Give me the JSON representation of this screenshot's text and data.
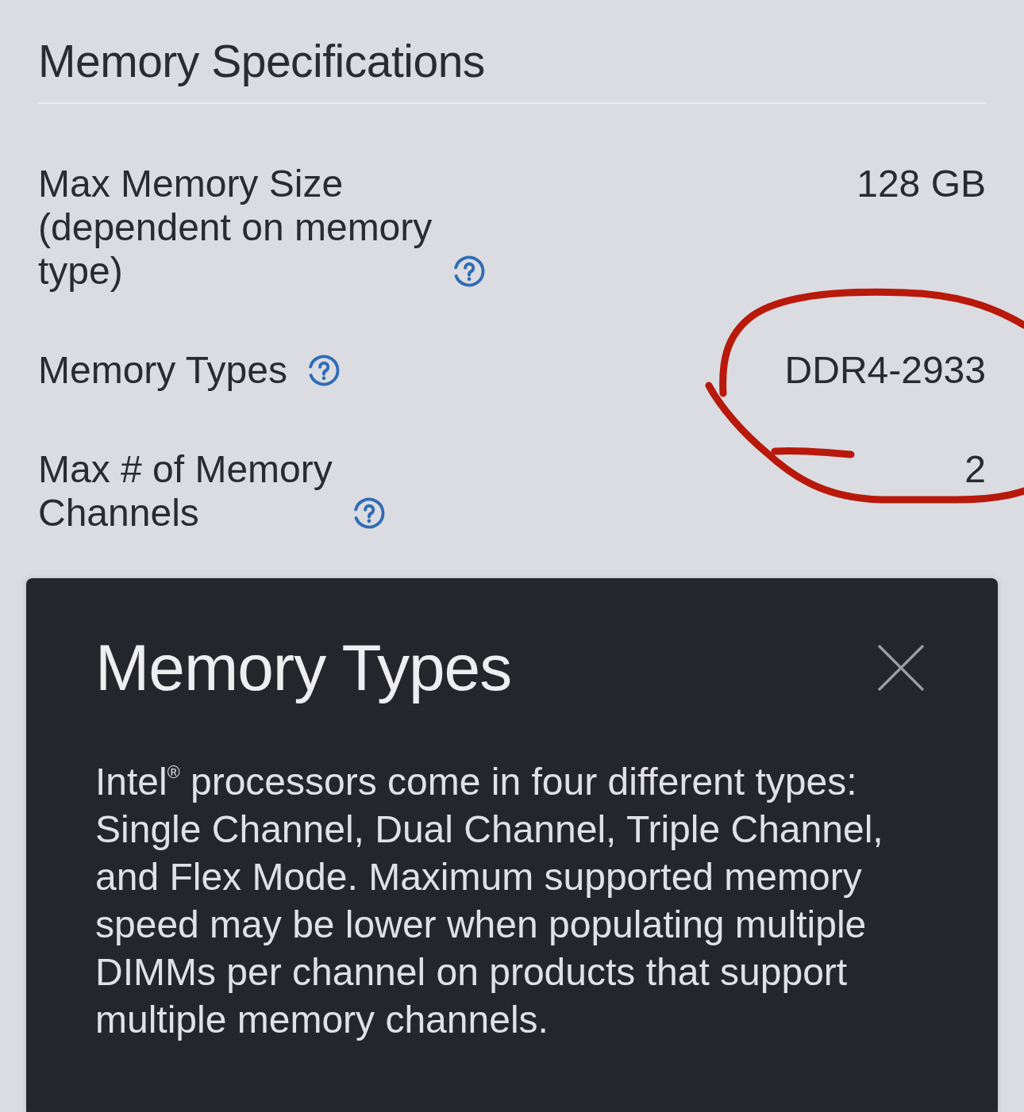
{
  "section": {
    "title": "Memory Specifications"
  },
  "specs": [
    {
      "label": "Max Memory Size (dependent on memory type)",
      "help": true,
      "value": "128 GB"
    },
    {
      "label": "Memory Types",
      "help": true,
      "value": "DDR4-2933"
    },
    {
      "label": "Max # of Memory Channels",
      "help": true,
      "value": "2"
    }
  ],
  "tooltip": {
    "title": "Memory Types",
    "body": "Intel$^{®}$ processors come in four different types: Single Channel, Dual Channel, Triple Channel, and Flex Mode. Maximum supported memory speed may be lower when populating multiple DIMMs per channel on products that support multiple memory channels."
  }
}
